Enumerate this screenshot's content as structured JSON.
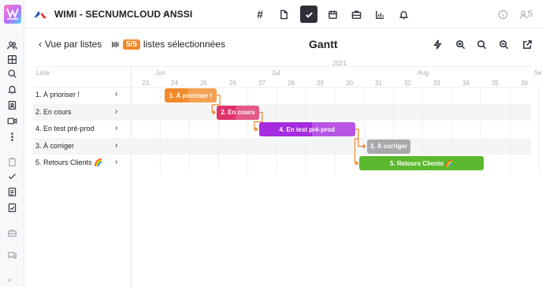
{
  "workspace": {
    "name": "WIMI - SECNUMCLOUD ANSSI",
    "users": "5"
  },
  "colors": {
    "accent": "#f28a2a",
    "active_tool": "#2e3138"
  },
  "toolbar": {
    "items": [
      {
        "name": "channels",
        "icon": "hash-icon"
      },
      {
        "name": "documents",
        "icon": "document-icon"
      },
      {
        "name": "tasks",
        "icon": "check-icon",
        "active": true
      },
      {
        "name": "calendar",
        "icon": "calendar-icon"
      },
      {
        "name": "projects",
        "icon": "briefcase-icon"
      },
      {
        "name": "reports",
        "icon": "bar-chart-icon"
      },
      {
        "name": "notifications",
        "icon": "bell-icon"
      }
    ],
    "hash_glyph": "#"
  },
  "header": {
    "back_label": "Vue par listes",
    "selected_badge": "5/5",
    "selected_label": "listes sélectionnées",
    "title": "Gantt"
  },
  "gantt": {
    "list_header": "Liste",
    "year": "2021",
    "months": [
      {
        "label": "Jun",
        "week": 24
      },
      {
        "label": "Jul",
        "week": 28
      },
      {
        "label": "Aug",
        "week": 33
      },
      {
        "label": "Sep",
        "week": 37
      }
    ],
    "weeks": [
      "23",
      "24",
      "25",
      "26",
      "27",
      "28",
      "29",
      "30",
      "31",
      "32",
      "33",
      "34",
      "35",
      "36"
    ],
    "rows": [
      {
        "label": "1. À prioriser !",
        "bar": "1. À prioriser !",
        "color": "#f28a2a",
        "progress": 0.45
      },
      {
        "label": "2. En cours",
        "bar": "2. En cours",
        "color": "#e0336a",
        "progress": 0.45
      },
      {
        "label": "4. En test pré-prod",
        "bar": "4. En test pré-prod",
        "color": "#a52bde",
        "progress": 0.55
      },
      {
        "label": "3. À corriger",
        "bar": "3. À corriger",
        "color": "#a8a9ad",
        "progress": 1.0
      },
      {
        "label": "5. Retours Clients 🌈",
        "bar": "5. Retours Clients 🌈",
        "color": "#5cb82e",
        "progress": 1.0
      }
    ]
  }
}
